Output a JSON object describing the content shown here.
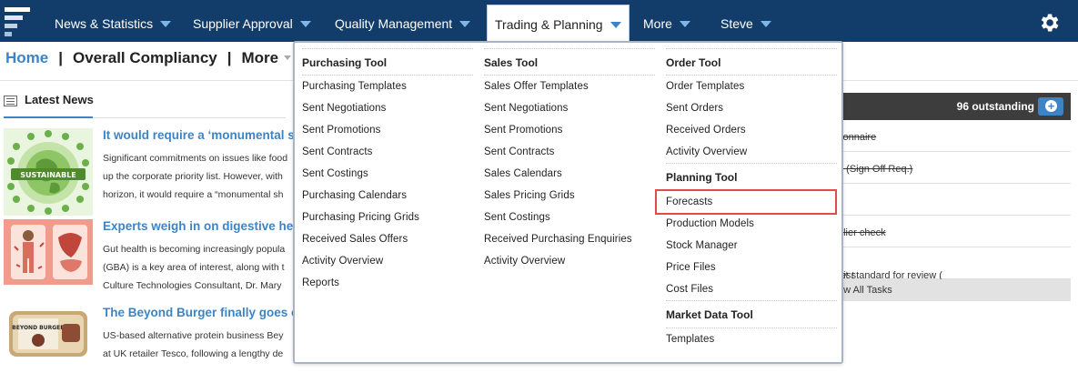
{
  "topnav": {
    "items": [
      {
        "label": "News & Statistics"
      },
      {
        "label": "Supplier Approval"
      },
      {
        "label": "Quality Management"
      },
      {
        "label": "Trading & Planning"
      },
      {
        "label": "More"
      },
      {
        "label": "Steve"
      }
    ],
    "active_index": 3,
    "brand_color": "#123d6b",
    "accent_color": "#3d84c6"
  },
  "breadcrumb": {
    "home": "Home",
    "separator": "|",
    "current": "Overall Compliancy",
    "more": "More"
  },
  "news": {
    "heading": "Latest News",
    "items": [
      {
        "thumb_label": "SUSTAINABLE",
        "title": "It would require a ‘monumental sh",
        "lines": [
          "Significant commitments on issues like food",
          "up the corporate priority list. However, with",
          "horizon, it would require a “monumental sh"
        ]
      },
      {
        "title": "Experts weigh in on digestive hea",
        "lines": [
          "Gut health is becoming increasingly popula",
          "(GBA) is a key area of interest, along with t",
          "Culture Technologies Consultant, Dr. Mary"
        ]
      },
      {
        "thumb_label": "BEYOND BURGER",
        "title": "The Beyond Burger finally goes o",
        "lines": [
          "US-based alternative protein business Bey",
          "at UK retailer Tesco, following a lengthy de"
        ]
      }
    ]
  },
  "tasks": {
    "outstanding": "96 outstanding",
    "rows": [
      {
        "text": "tionnaire",
        "strike": true
      },
      {
        "text": "n (Sign Off Req.)",
        "strike": true
      },
      {
        "text": "",
        "strike": false
      },
      {
        "text": "plier check",
        "strike": true
      },
      {
        "text": "dit standard for review (",
        "italic": "test",
        "suffix": ")"
      }
    ],
    "footer": "ew All Tasks"
  },
  "menu": {
    "columns": [
      {
        "sections": [
          {
            "heading": "Purchasing Tool",
            "items": [
              "Purchasing Templates",
              "Sent Negotiations",
              "Sent Promotions",
              "Sent Contracts",
              "Sent Costings",
              "Purchasing Calendars",
              "Purchasing Pricing Grids",
              "Received Sales Offers",
              "Activity Overview",
              "Reports"
            ]
          }
        ]
      },
      {
        "sections": [
          {
            "heading": "Sales Tool",
            "items": [
              "Sales Offer Templates",
              "Sent Negotiations",
              "Sent Promotions",
              "Sent Contracts",
              "Sales Calendars",
              "Sales Pricing Grids",
              "Sent Costings",
              "Received Purchasing Enquiries",
              "Activity Overview"
            ]
          }
        ]
      },
      {
        "sections": [
          {
            "heading": "Order Tool",
            "items": [
              "Order Templates",
              "Sent Orders",
              "Received Orders",
              "Activity Overview"
            ]
          },
          {
            "heading": "Planning Tool",
            "items": [
              "Forecasts",
              "Production Models",
              "Stock Manager",
              "Price Files",
              "Cost Files"
            ]
          },
          {
            "heading": "Market Data Tool",
            "items": [
              "Templates"
            ]
          }
        ]
      }
    ],
    "highlighted_item": "Forecasts",
    "highlight_color": "#e14b4b"
  }
}
